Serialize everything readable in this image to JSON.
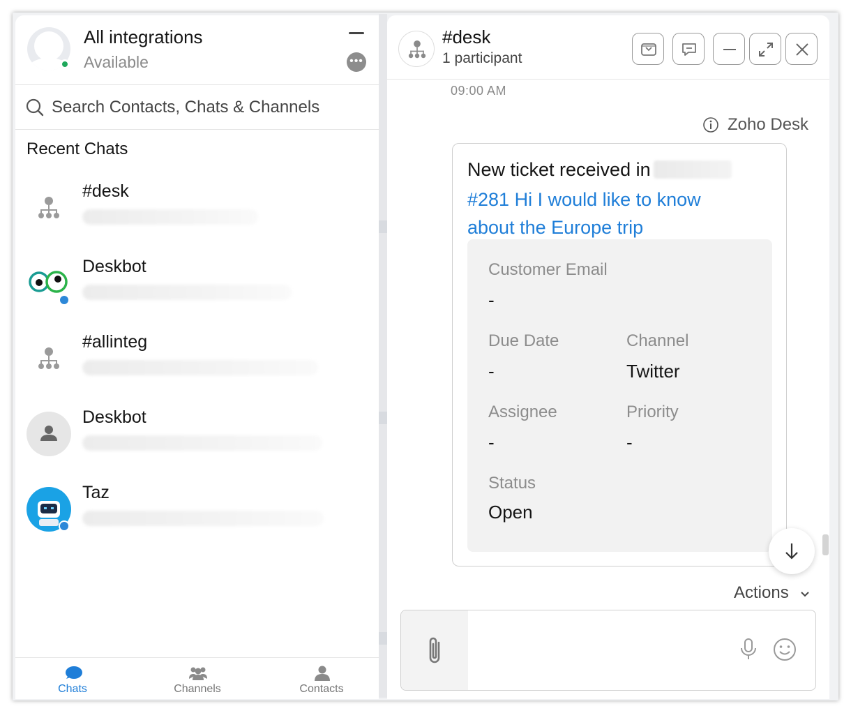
{
  "left_panel": {
    "title": "All integrations",
    "status": "Available",
    "search_placeholder": "Search Contacts, Chats & Channels",
    "section_title": "Recent Chats",
    "chats": [
      {
        "name": "#desk"
      },
      {
        "name": "Deskbot"
      },
      {
        "name": "#allinteg"
      },
      {
        "name": "Deskbot"
      },
      {
        "name": "Taz"
      }
    ],
    "nav": [
      {
        "label": "Chats",
        "icon": "chat-bubble-icon"
      },
      {
        "label": "Channels",
        "icon": "group-icon"
      },
      {
        "label": "Contacts",
        "icon": "person-icon"
      }
    ]
  },
  "right_panel": {
    "channel_name": "#desk",
    "participants": "1 participant",
    "timestamp": "09:00 AM",
    "sender": "Zoho Desk",
    "card": {
      "heading": "New ticket received in",
      "link": "#281 Hi I would like to know about the Europe trip",
      "fields": {
        "customer_email_label": "Customer Email",
        "customer_email_value": "-",
        "due_date_label": "Due Date",
        "due_date_value": "-",
        "channel_label": "Channel",
        "channel_value": "Twitter",
        "assignee_label": "Assignee",
        "assignee_value": "-",
        "priority_label": "Priority",
        "priority_value": "-",
        "status_label": "Status",
        "status_value": "Open"
      }
    },
    "actions_label": "Actions"
  },
  "colors": {
    "accent": "#1f7ed8",
    "online": "#1fa85b",
    "muted_text": "#8c8c8c"
  }
}
